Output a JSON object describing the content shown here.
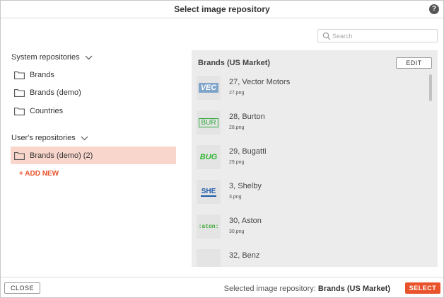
{
  "dialog": {
    "title": "Select image repository",
    "help_label": "?"
  },
  "search": {
    "placeholder": "Search",
    "value": ""
  },
  "system_repositories": {
    "heading": "System repositories",
    "items": [
      {
        "label": "Brands"
      },
      {
        "label": "Brands (demo)"
      },
      {
        "label": "Countries"
      }
    ]
  },
  "user_repositories": {
    "heading": "User's repositories",
    "items": [
      {
        "label": "Brands (demo) (2)",
        "selected": true
      }
    ],
    "add_new_label": "+ ADD NEW"
  },
  "panel": {
    "title": "Brands (US Market)",
    "edit_label": "EDIT",
    "images": [
      {
        "title": "27, Vector Motors",
        "file": "27.png",
        "logo_text": "VEC",
        "logo_color": "#7fa3c9"
      },
      {
        "title": "28, Burton",
        "file": "28.png",
        "logo_text": "BUR",
        "logo_color": "#2eaa3c"
      },
      {
        "title": "29, Bugatti",
        "file": "29.png",
        "logo_text": "BUG",
        "logo_color": "#2fb532"
      },
      {
        "title": "3, Shelby",
        "file": "3.png",
        "logo_text": "SHE",
        "logo_color": "#1e5aa8"
      },
      {
        "title": "30, Aston",
        "file": "30.png",
        "logo_text": ":aton:",
        "logo_color": "#3aa832"
      },
      {
        "title": "32, Benz",
        "file": "",
        "logo_text": "",
        "logo_color": "#9fc9d0"
      }
    ]
  },
  "footer": {
    "close_label": "CLOSE",
    "selected_prefix": "Selected image repository:",
    "selected_value": "Brands (US Market)",
    "select_label": "SELECT"
  },
  "colors": {
    "accent": "#e8532b",
    "selected_bg": "#f8d6cc",
    "panel_bg": "#ececec"
  }
}
